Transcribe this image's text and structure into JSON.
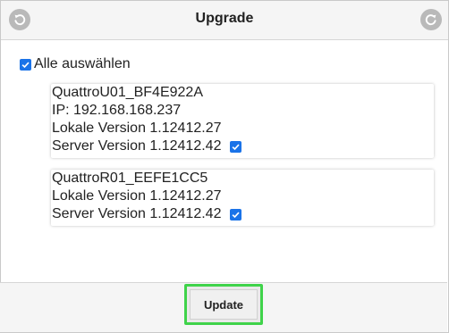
{
  "header": {
    "title": "Upgrade",
    "back_icon": "back-arrow-icon",
    "refresh_icon": "refresh-icon"
  },
  "select_all": {
    "label": "Alle auswählen",
    "checked": true
  },
  "devices": [
    {
      "name": "QuattroU01_BF4E922A",
      "ip": "IP: 192.168.168.237",
      "local_version": "Lokale Version 1.12412.27",
      "server_version": "Server Version 1.12412.42",
      "checked": true
    },
    {
      "name": "QuattroR01_EEFE1CC5",
      "local_version": "Lokale Version 1.12412.27",
      "server_version": "Server Version 1.12412.42",
      "checked": true
    }
  ],
  "footer": {
    "update_label": "Update"
  },
  "colors": {
    "accent": "#1a73e8",
    "highlight": "#3fd34a"
  }
}
